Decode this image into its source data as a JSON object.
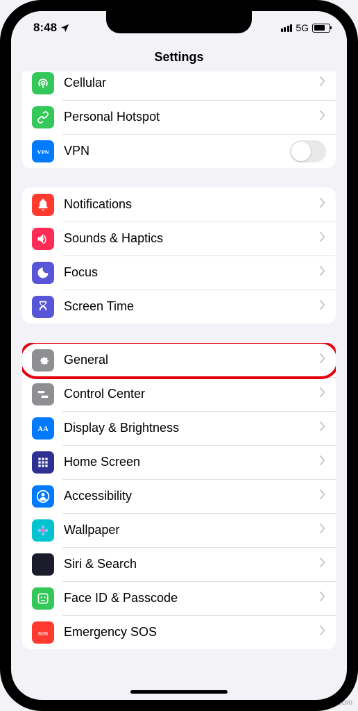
{
  "status": {
    "time": "8:48",
    "net": "5G"
  },
  "header": {
    "title": "Settings"
  },
  "groups": [
    {
      "rows": [
        {
          "name": "cellular",
          "label": "Cellular",
          "iconBg": "#34c759",
          "accessory": "chevron",
          "icon": "antenna"
        },
        {
          "name": "personal-hotspot",
          "label": "Personal Hotspot",
          "iconBg": "#34c759",
          "accessory": "chevron",
          "icon": "link"
        },
        {
          "name": "vpn",
          "label": "VPN",
          "iconBg": "#007aff",
          "accessory": "toggle",
          "icon": "vpn"
        }
      ]
    },
    {
      "rows": [
        {
          "name": "notifications",
          "label": "Notifications",
          "iconBg": "#ff3b30",
          "accessory": "chevron",
          "icon": "bell"
        },
        {
          "name": "sounds-haptics",
          "label": "Sounds & Haptics",
          "iconBg": "#ff2d55",
          "accessory": "chevron",
          "icon": "speaker"
        },
        {
          "name": "focus",
          "label": "Focus",
          "iconBg": "#5856d6",
          "accessory": "chevron",
          "icon": "moon"
        },
        {
          "name": "screen-time",
          "label": "Screen Time",
          "iconBg": "#5856d6",
          "accessory": "chevron",
          "icon": "hourglass"
        }
      ]
    },
    {
      "rows": [
        {
          "name": "general",
          "label": "General",
          "iconBg": "#8e8e93",
          "accessory": "chevron",
          "icon": "gear",
          "highlight": true
        },
        {
          "name": "control-center",
          "label": "Control Center",
          "iconBg": "#8e8e93",
          "accessory": "chevron",
          "icon": "switches"
        },
        {
          "name": "display-brightness",
          "label": "Display & Brightness",
          "iconBg": "#007aff",
          "accessory": "chevron",
          "icon": "aa"
        },
        {
          "name": "home-screen",
          "label": "Home Screen",
          "iconBg": "#2e3192",
          "accessory": "chevron",
          "icon": "grid"
        },
        {
          "name": "accessibility",
          "label": "Accessibility",
          "iconBg": "#007aff",
          "accessory": "chevron",
          "icon": "person"
        },
        {
          "name": "wallpaper",
          "label": "Wallpaper",
          "iconBg": "#00c3d0",
          "accessory": "chevron",
          "icon": "flower"
        },
        {
          "name": "siri-search",
          "label": "Siri & Search",
          "iconBg": "#1b1b2b",
          "accessory": "chevron",
          "icon": "siri"
        },
        {
          "name": "face-id-passcode",
          "label": "Face ID & Passcode",
          "iconBg": "#34c759",
          "accessory": "chevron",
          "icon": "face"
        },
        {
          "name": "emergency-sos",
          "label": "Emergency SOS",
          "iconBg": "#ff3b30",
          "accessory": "chevron",
          "icon": "sos"
        }
      ]
    }
  ],
  "watermark": "wsxdn.com"
}
